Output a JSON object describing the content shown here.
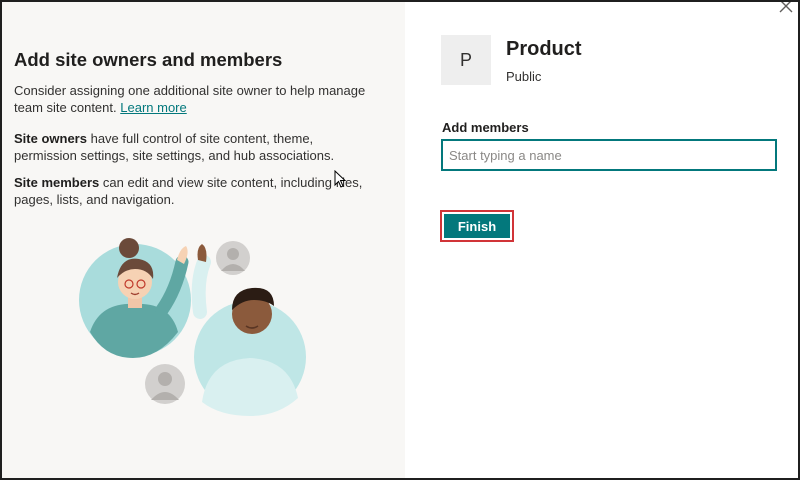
{
  "left": {
    "title": "Add site owners and members",
    "intro": "Consider assigning one additional site owner to help manage team site content.",
    "learn_more": "Learn more",
    "owners_term": "Site owners",
    "owners_text": "have full control of site content, theme, permission settings, site settings, and hub associations.",
    "members_term": "Site members",
    "members_text": "can edit and view site content, including files, pages, lists, and navigation."
  },
  "site": {
    "logo_letter": "P",
    "name": "Product",
    "privacy": "Public"
  },
  "members": {
    "label": "Add members",
    "placeholder": "Start typing a name",
    "value": ""
  },
  "actions": {
    "finish_label": "Finish"
  },
  "colors": {
    "accent": "#03787c",
    "highlight_border": "#d13438",
    "left_bg": "#f8f7f5"
  },
  "icons": {
    "close": "close-icon",
    "cursor": "mouse-pointer-icon"
  }
}
